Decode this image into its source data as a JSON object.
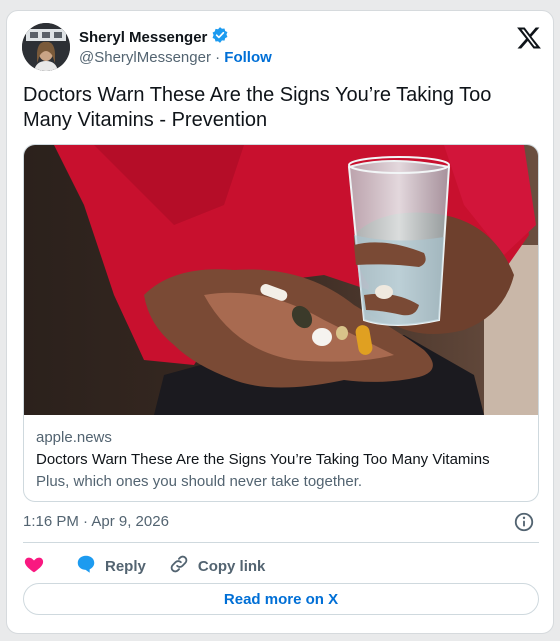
{
  "author": {
    "name": "Sheryl Messenger",
    "handle": "@SherylMessenger",
    "separator": "·",
    "follow_label": "Follow",
    "verified_color": "#1d9bf0"
  },
  "tweet": {
    "text": "Doctors Warn These Are the Signs You’re Taking Too Many Vitamins - Prevention"
  },
  "link_card": {
    "image": "hand-holding-pills-and-water-glass",
    "domain": "apple.news",
    "title": "Doctors Warn These Are the Signs You’re Taking Too Many Vitamins",
    "description": "Plus, which ones you should never take together."
  },
  "meta": {
    "timestamp": "1:16 PM · Apr 9, 2026"
  },
  "actions": {
    "like_icon": "heart-icon",
    "reply_label": "Reply",
    "copy_label": "Copy link",
    "like_color": "#f91880",
    "reply_color": "#1d9bf0"
  },
  "read_more_label": "Read more on X"
}
